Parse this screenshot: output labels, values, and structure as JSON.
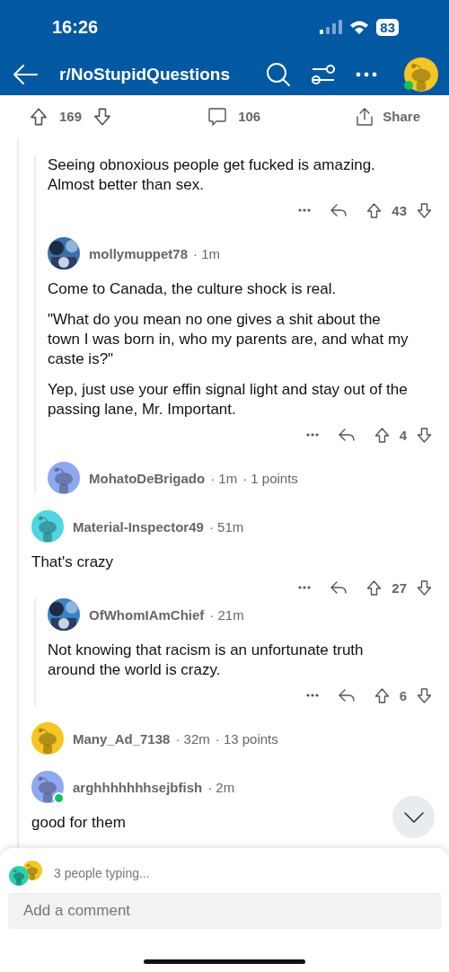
{
  "status_bar": {
    "time": "16:26",
    "battery": "83"
  },
  "nav": {
    "title": "r/NoStupidQuestions",
    "avatar": {
      "kind": "snoo",
      "color": "#f5c623"
    },
    "online": true
  },
  "post_actions": {
    "votes": "169",
    "comments": "106",
    "share": "Share"
  },
  "comments": [
    {
      "children": [
        {
          "body": [
            "Seeing obnoxious people get fucked is amazing. Almost better than sex."
          ],
          "votes": "43"
        },
        {
          "author": "mollymuppet78",
          "age": "· 1m",
          "avatar": {
            "kind": "picture",
            "color": "#3f6fa8"
          },
          "online": false,
          "body": [
            "Come to Canada, the culture shock is real.",
            "\"What do you mean no one gives a shit about the town I was born in, who my parents are, and what my caste is?\"",
            "Yep, just use your effin signal light and stay out of the passing lane, Mr. Important."
          ],
          "votes": "4"
        },
        {
          "author": "MohatoDeBrigado",
          "age": "· 1m",
          "points": "· 1 points",
          "avatar": {
            "kind": "snoo",
            "color": "#8fa8f0"
          },
          "online": false
        }
      ]
    },
    {
      "author": "Material-Inspector49",
      "age": "· 51m",
      "avatar": {
        "kind": "snoo",
        "color": "#4fd6e0"
      },
      "online": false,
      "body": [
        "That's crazy"
      ],
      "votes": "27",
      "children": [
        {
          "author": "OfWhomIAmChief",
          "age": "· 21m",
          "avatar": {
            "kind": "picture",
            "color": "#3b82c4"
          },
          "online": false,
          "body": [
            "Not knowing that racism is an unfortunate truth around the world is crazy."
          ],
          "votes": "6"
        }
      ]
    },
    {
      "author": "Many_Ad_7138",
      "age": "· 32m",
      "points": "· 13 points",
      "avatar": {
        "kind": "snoo",
        "color": "#f5c623"
      },
      "online": false
    },
    {
      "author": "arghhhhhhhsejbfish",
      "age": "· 2m",
      "avatar": {
        "kind": "snoo",
        "color": "#8fa8f0"
      },
      "online": true,
      "body": [
        "good for them"
      ]
    }
  ],
  "composer": {
    "typing": "3 people typing...",
    "typing_avatars": [
      {
        "kind": "snoo",
        "color": "#2ed0b0"
      },
      {
        "kind": "snoo",
        "color": "#f5c623"
      }
    ],
    "placeholder": "Add a comment"
  }
}
